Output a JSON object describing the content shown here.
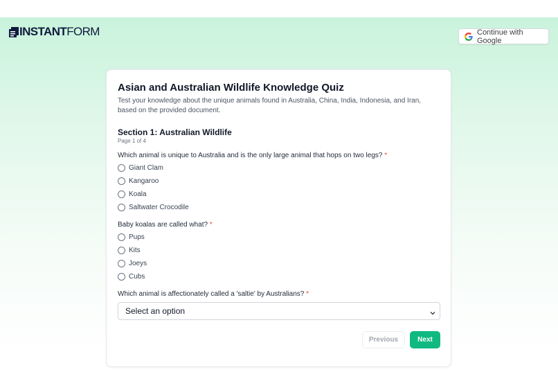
{
  "header": {
    "logo": {
      "bold": "INSTANT",
      "light": "FORM",
      "icon": "form-logo-icon"
    },
    "google_button": {
      "label": "Continue with Google",
      "icon": "google-icon"
    }
  },
  "form": {
    "title": "Asian and Australian Wildlife Knowledge Quiz",
    "description": "Test your knowledge about the unique animals found in Australia, China, India, Indonesia, and Iran, based on the provided document.",
    "section_title": "Section 1: Australian Wildlife",
    "page_indicator": "Page 1 of 4",
    "questions": [
      {
        "text": "Which animal is unique to Australia and is the only large animal that hops on two legs?",
        "required": "*",
        "options": [
          "Giant Clam",
          "Kangaroo",
          "Koala",
          "Saltwater Crocodile"
        ]
      },
      {
        "text": "Baby koalas are called what?",
        "required": "*",
        "options": [
          "Pups",
          "Kits",
          "Joeys",
          "Cubs"
        ]
      },
      {
        "text": "Which animal is affectionately called a 'saltie' by Australians?",
        "required": "*",
        "select_value": "Select an option"
      }
    ],
    "buttons": {
      "previous": "Previous",
      "next": "Next"
    }
  },
  "colors": {
    "accent": "#10b981",
    "required": "#ef4444",
    "background_gradient_top": "#c9f3dc"
  }
}
